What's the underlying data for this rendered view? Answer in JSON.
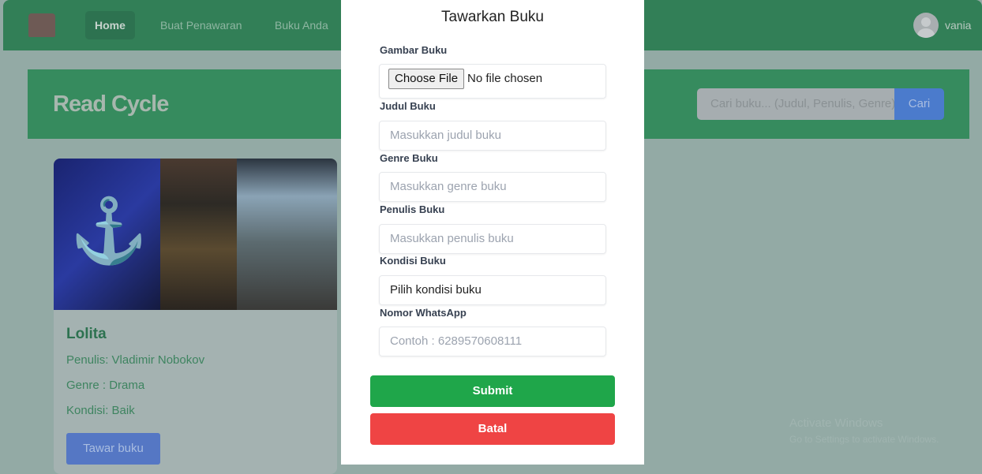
{
  "nav": {
    "items": [
      "Home",
      "Buat Penawaran",
      "Buku Anda"
    ],
    "user": "vania"
  },
  "banner": {
    "brand": "Read Cycle",
    "search_placeholder": "Cari buku... (Judul, Penulis, Genre)",
    "search_button": "Cari"
  },
  "card": {
    "title": "Lolita",
    "author": "Penulis: Vladimir Nobokov",
    "genre": "Genre : Drama",
    "condition": "Kondisi: Baik",
    "button": "Tawar buku"
  },
  "modal": {
    "title": "Tawarkan Buku",
    "fields": [
      {
        "label": "Gambar Buku",
        "button": "Choose File",
        "status": "No file chosen"
      },
      {
        "label": "Judul Buku",
        "placeholder": "Masukkan judul buku"
      },
      {
        "label": "Genre Buku",
        "placeholder": "Masukkan genre buku"
      },
      {
        "label": "Penulis Buku",
        "placeholder": "Masukkan penulis buku"
      },
      {
        "label": "Kondisi Buku",
        "value": "Pilih kondisi buku"
      },
      {
        "label": "Nomor WhatsApp",
        "placeholder": "Contoh : 6289570608111"
      }
    ],
    "submit": "Submit",
    "cancel": "Batal"
  },
  "watermark": {
    "line1": "Activate Windows",
    "line2": "Go to Settings to activate Windows."
  }
}
